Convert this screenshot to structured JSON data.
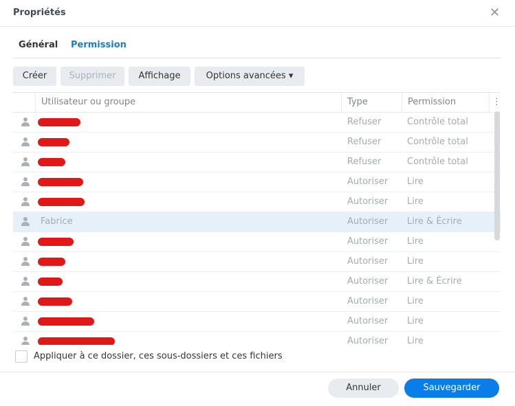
{
  "dialog": {
    "title": "Propriétés",
    "close_icon": "close-icon"
  },
  "tabs": [
    {
      "label": "Général"
    },
    {
      "label": "Permission",
      "active": true
    }
  ],
  "toolbar": {
    "create": "Créer",
    "delete": "Supprimer",
    "display": "Affichage",
    "advanced": "Options avancées ▾"
  },
  "table": {
    "headers": {
      "user": "Utilisateur ou groupe",
      "type": "Type",
      "permission": "Permission"
    },
    "rows": [
      {
        "name": "",
        "type": "Refuser",
        "permission": "Contrôle total"
      },
      {
        "name": "",
        "type": "Refuser",
        "permission": "Contrôle total"
      },
      {
        "name": "",
        "type": "Refuser",
        "permission": "Contrôle total"
      },
      {
        "name": "",
        "type": "Autoriser",
        "permission": "Lire"
      },
      {
        "name": "",
        "type": "Autoriser",
        "permission": "Lire"
      },
      {
        "name": "Fabrice",
        "type": "Autoriser",
        "permission": "Lire & Écrire",
        "selected": true
      },
      {
        "name": "",
        "type": "Autoriser",
        "permission": "Lire"
      },
      {
        "name": "",
        "type": "Autoriser",
        "permission": "Lire"
      },
      {
        "name": "",
        "type": "Autoriser",
        "permission": "Lire & Écrire"
      },
      {
        "name": "",
        "type": "Autoriser",
        "permission": "Lire"
      },
      {
        "name": "",
        "type": "Autoriser",
        "permission": "Lire"
      },
      {
        "name": "",
        "type": "Autoriser",
        "permission": "Lire"
      }
    ]
  },
  "apply_checkbox": {
    "label": "Appliquer à ce dossier, ces sous-dossiers et ces fichiers",
    "checked": false
  },
  "footer": {
    "cancel": "Annuler",
    "save": "Sauvegarder"
  },
  "colors": {
    "accent": "#1e7ac2",
    "primary_button": "#0a7ee8",
    "redaction": "#e01818"
  }
}
